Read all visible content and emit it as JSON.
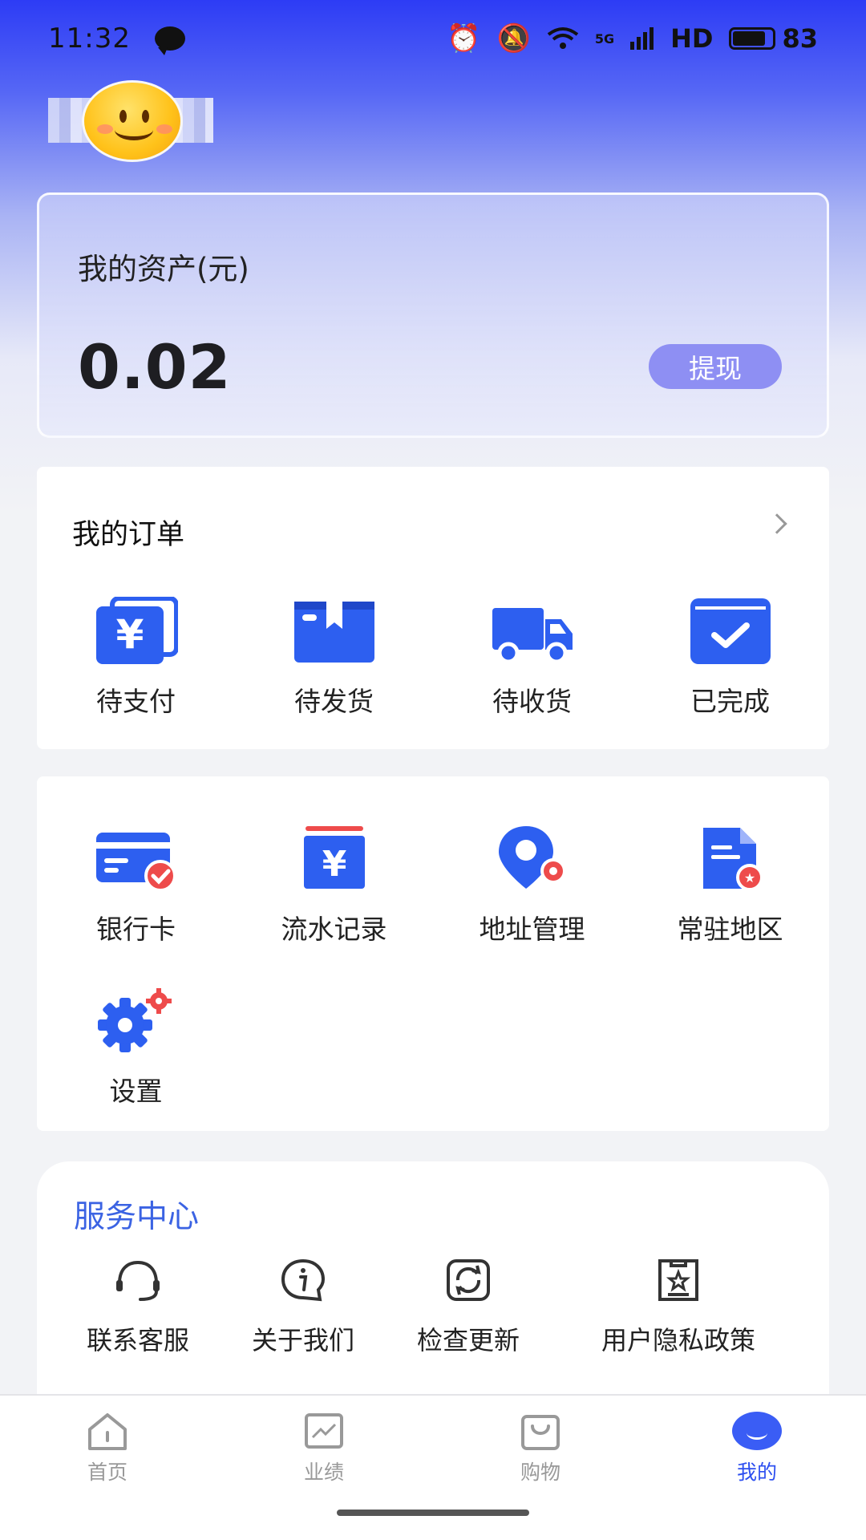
{
  "status_bar": {
    "time": "11:32",
    "network": "5G",
    "hd": "HD",
    "battery": "83"
  },
  "colors": {
    "primary": "#2d4ff0",
    "accent_button": "#8e8ff3",
    "service_title": "#3b63e3",
    "badge_red": "#ee4b4b"
  },
  "profile": {
    "avatar_icon": "smiley-face-icon"
  },
  "assets": {
    "title": "我的资产(元)",
    "value": "0.02",
    "withdraw_label": "提现"
  },
  "orders": {
    "title": "我的订单",
    "items": [
      {
        "label": "待支付",
        "icon": "yen-card-icon"
      },
      {
        "label": "待发货",
        "icon": "package-box-icon"
      },
      {
        "label": "待收货",
        "icon": "truck-icon"
      },
      {
        "label": "已完成",
        "icon": "check-box-icon"
      }
    ]
  },
  "tools": {
    "items": [
      {
        "label": "银行卡",
        "icon": "bank-card-icon"
      },
      {
        "label": "流水记录",
        "icon": "ledger-icon"
      },
      {
        "label": "地址管理",
        "icon": "location-settings-icon"
      },
      {
        "label": "常驻地区",
        "icon": "document-badge-icon"
      },
      {
        "label": "设置",
        "icon": "gear-icon"
      }
    ]
  },
  "service_center": {
    "title": "服务中心",
    "items": [
      {
        "label": "联系客服",
        "icon": "headset-icon"
      },
      {
        "label": "关于我们",
        "icon": "info-bubble-icon"
      },
      {
        "label": "检查更新",
        "icon": "refresh-icon"
      },
      {
        "label": "用户隐私政策",
        "icon": "privacy-doc-icon"
      }
    ]
  },
  "bottom_nav": {
    "active": "我的",
    "items": [
      {
        "label": "首页",
        "icon": "home-icon"
      },
      {
        "label": "业绩",
        "icon": "chart-icon"
      },
      {
        "label": "购物",
        "icon": "shopping-bag-icon"
      },
      {
        "label": "我的",
        "icon": "profile-icon"
      }
    ]
  }
}
